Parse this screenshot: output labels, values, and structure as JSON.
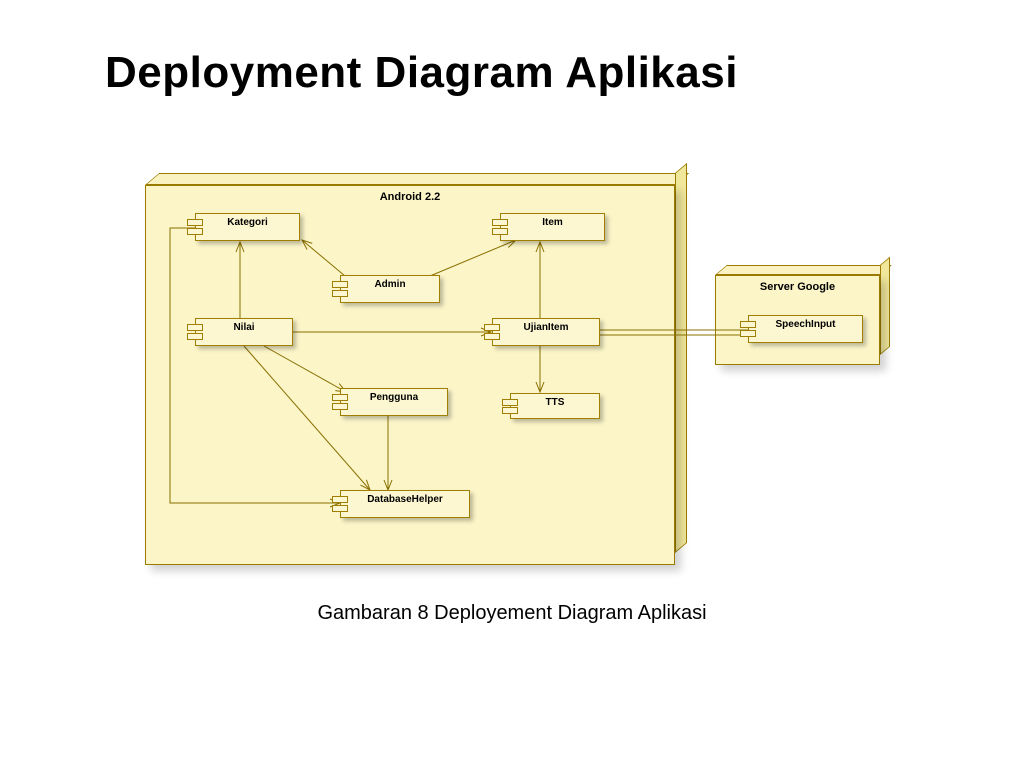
{
  "title": "Deployment Diagram Aplikasi",
  "caption": "Gambaran 8 Deployement Diagram Aplikasi",
  "nodes": {
    "android": {
      "label": "Android 2.2"
    },
    "server": {
      "label": "Server Google"
    }
  },
  "components": {
    "kategori": "Kategori",
    "item": "Item",
    "admin": "Admin",
    "nilai": "Nilai",
    "ujianitem": "UjianItem",
    "pengguna": "Pengguna",
    "tts": "TTS",
    "databasehelper": "DatabaseHelper",
    "speechinput": "SpeechInput"
  },
  "associations": [
    [
      "Admin",
      "Kategori"
    ],
    [
      "Admin",
      "Item"
    ],
    [
      "Nilai",
      "Kategori"
    ],
    [
      "Nilai",
      "UjianItem"
    ],
    [
      "Nilai",
      "Pengguna"
    ],
    [
      "Nilai",
      "DatabaseHelper"
    ],
    [
      "UjianItem",
      "Item"
    ],
    [
      "UjianItem",
      "TTS"
    ],
    [
      "Pengguna",
      "DatabaseHelper"
    ],
    [
      "Kategori",
      "DatabaseHelper"
    ],
    [
      "UjianItem",
      "SpeechInput"
    ]
  ],
  "colors": {
    "fill": "#fbf5c8",
    "edge": "#9a7b00"
  }
}
